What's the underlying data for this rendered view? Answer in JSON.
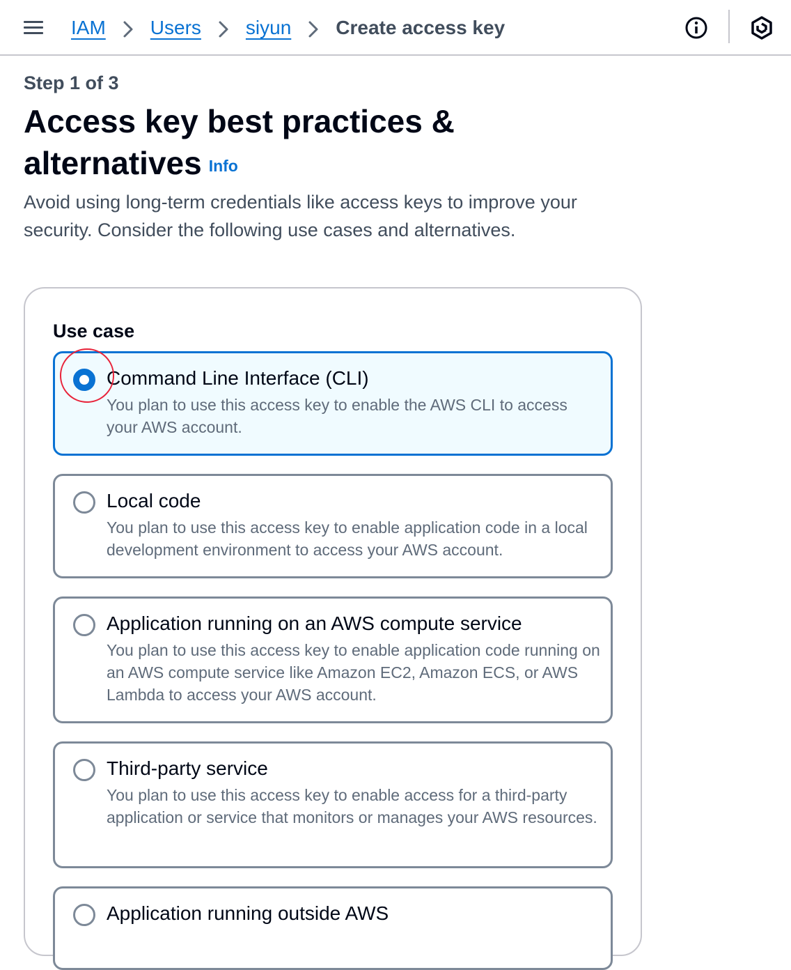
{
  "header": {
    "menu_icon": "hamburger-menu-icon",
    "breadcrumbs": [
      {
        "label": "IAM"
      },
      {
        "label": "Users"
      },
      {
        "label": "siyun"
      }
    ],
    "current": "Create access key",
    "info_icon": "info-circle-icon",
    "profile_icon": "hexagon-icon"
  },
  "page": {
    "step": "Step 1 of 3",
    "title": "Access key best practices & alternatives",
    "info_link": "Info",
    "description": "Avoid using long-term credentials like access keys to improve your security. Consider the following use cases and alternatives."
  },
  "usecase": {
    "label": "Use case",
    "selected": "Command Line Interface (CLI)",
    "options": [
      {
        "title": "Command Line Interface (CLI)",
        "description": "You plan to use this access key to enable the AWS CLI to access your AWS account."
      },
      {
        "title": "Local code",
        "description": "You plan to use this access key to enable application code in a local development environment to access your AWS account."
      },
      {
        "title": "Application running on an AWS compute service",
        "description": "You plan to use this access key to enable application code running on an AWS compute service like Amazon EC2, Amazon ECS, or AWS Lambda to access your AWS account."
      },
      {
        "title": "Third-party service",
        "description": "You plan to use this access key to enable access for a third-party application or service that monitors or manages your AWS resources."
      },
      {
        "title": "Application running outside AWS",
        "description": ""
      }
    ]
  },
  "colors": {
    "accent": "#0972d3",
    "selected_bg": "#f0fbff",
    "marker": "#e8233a"
  }
}
